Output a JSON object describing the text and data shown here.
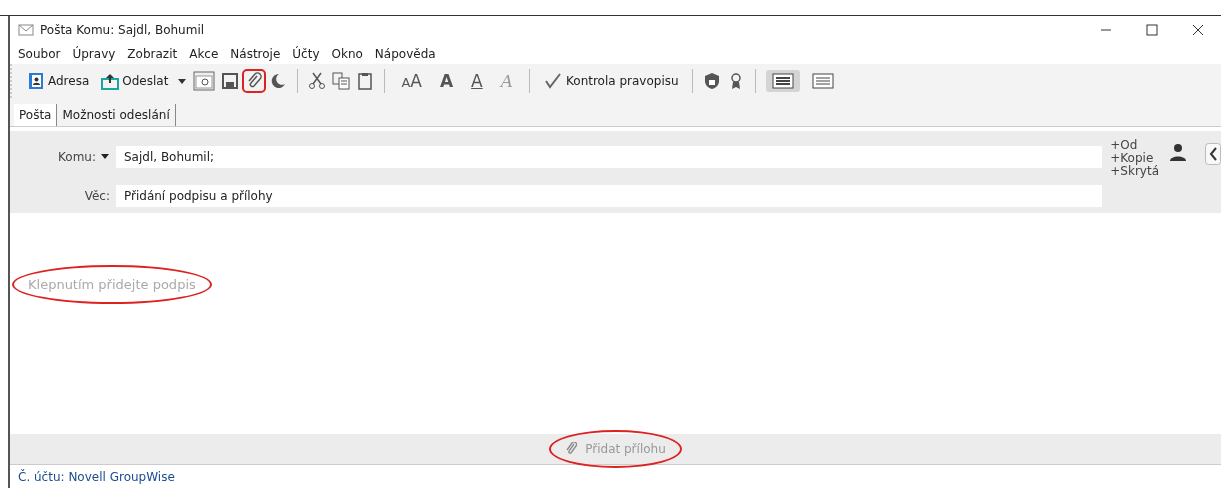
{
  "window": {
    "title": "Pošta Komu: Sajdl, Bohumil"
  },
  "menu": [
    "Soubor",
    "Úpravy",
    "Zobrazit",
    "Akce",
    "Nástroje",
    "Účty",
    "Okno",
    "Nápověda"
  ],
  "toolbar": {
    "address_button": "Adresa",
    "send_button": "Odeslat",
    "font_buttons": [
      {
        "label": "AA",
        "kind": "size"
      },
      {
        "label": "A",
        "kind": "bold"
      },
      {
        "label": "A",
        "kind": "underline"
      },
      {
        "label": "A",
        "kind": "italic"
      }
    ],
    "spellcheck_button": "Kontrola pravopisu",
    "view_buttons": [
      {
        "selected": true
      },
      {
        "selected": false
      }
    ]
  },
  "tabs": [
    {
      "label": "Pošta",
      "selected": true
    },
    {
      "label": "Možnosti odeslání",
      "selected": false
    }
  ],
  "header": {
    "to_label": "Komu:",
    "to_value": "Sajdl, Bohumil;",
    "subject_label": "Věc:",
    "subject_value": "Přidání podpisu a přílohy",
    "recipient_links": [
      "+Od",
      "+Kopie",
      "+Skrytá"
    ]
  },
  "body": {
    "signature_placeholder": "Klepnutím přidejte podpis"
  },
  "attach_bar": {
    "label": "Přidat přílohu"
  },
  "status_bar": {
    "account": "Č. účtu: Novell GroupWise"
  }
}
